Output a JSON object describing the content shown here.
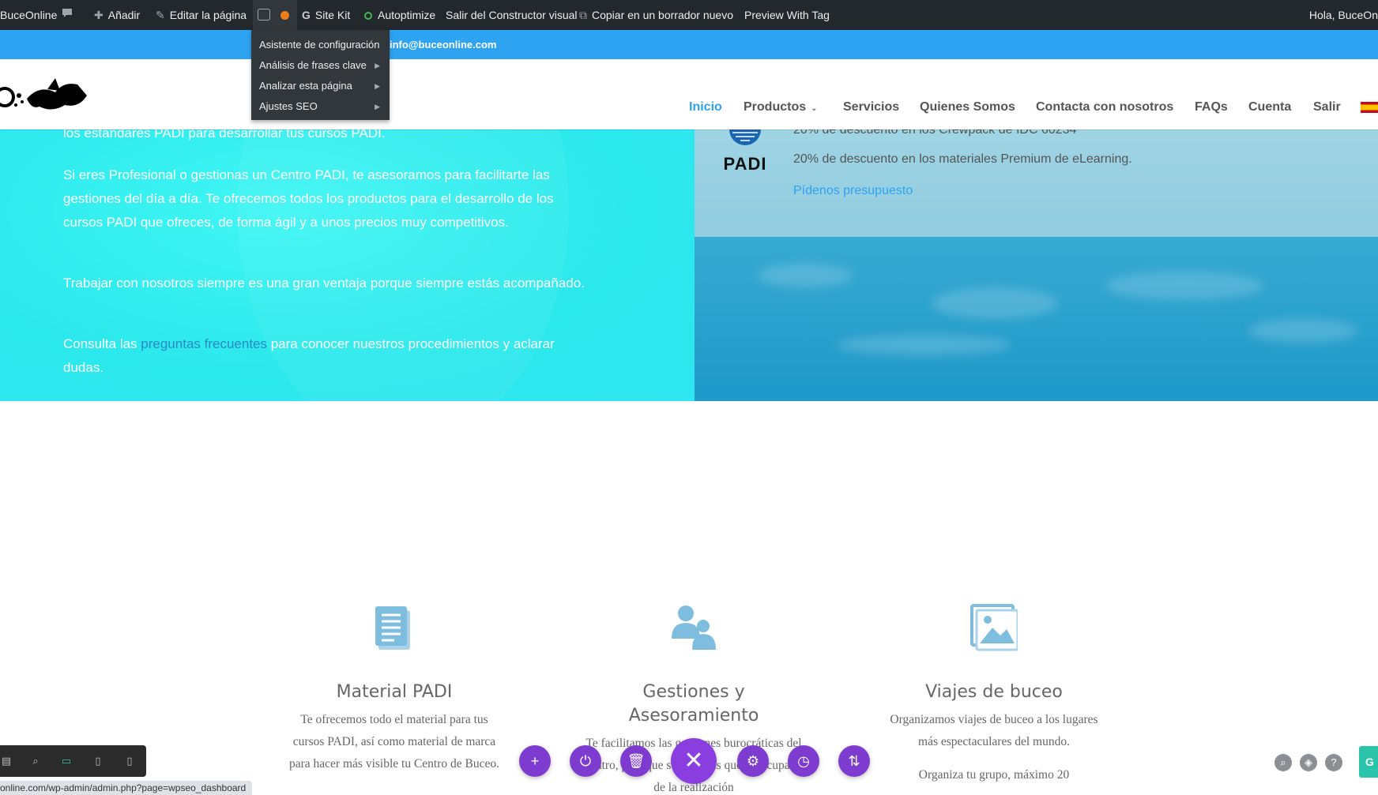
{
  "adminbar": {
    "site_name": "BuceOnline",
    "add_label": "Añadir",
    "edit_label": "Editar la página",
    "sitekit_label": "Site Kit",
    "autoptimize_label": "Autoptimize",
    "exit_builder_label": "Salir del Constructor visual",
    "copy_draft_label": "Copiar en un borrador nuevo",
    "preview_tag_label": "Preview With Tag",
    "greeting": "Hola, BuceOn"
  },
  "yoast_menu": {
    "items": [
      {
        "label": "Asistente de configuración",
        "submenu": false
      },
      {
        "label": "Análisis de frases clave",
        "submenu": true
      },
      {
        "label": "Analizar esta página",
        "submenu": true
      },
      {
        "label": "Ajustes SEO",
        "submenu": true
      }
    ]
  },
  "topbar": {
    "email": "info@buceonline.com"
  },
  "nav": {
    "items": [
      "Inicio",
      "Productos",
      "Servicios",
      "Quienes Somos",
      "Contacta con nosotros",
      "FAQs",
      "Cuenta",
      "Salir"
    ]
  },
  "hero": {
    "p1": "los estándares PADI para desarrollar tus cursos PADI.",
    "p2": "Si eres Profesional o gestionas un Centro PADI, te asesoramos para facilitarte las gestiones del día a día. Te ofrecemos todos los productos para el desarrollo de los cursos PADI que ofreces, de forma ágil y a unos precios muy competitivos.",
    "p3": "Trabajar con nosotros siempre es una gran ventaja porque siempre estás acompañado.",
    "p4_before": "Consulta las ",
    "p4_link": "preguntas frecuentes",
    "p4_after": " para conocer nuestros procedimientos y aclarar dudas."
  },
  "offer": {
    "padi_label": "PADI",
    "line1": "20% de descuento en los Crewpack de IDC 60234",
    "line2": "20% de descuento en los materiales Premium de eLearning.",
    "link": "Pídenos presupuesto"
  },
  "features": [
    {
      "title": "Material PADI",
      "text": "Te ofrecemos todo el material para tus cursos PADI, así como material de marca para hacer más visible tu Centro de Buceo."
    },
    {
      "title": "Gestiones y Asesoramiento",
      "text": "Te facilitamos las gestiones burocráticas del centro, para que solo tengas que preocuparte de la realización"
    },
    {
      "title": "Viajes de buceo",
      "text": "Organizamos viajes de buceo a los lugares más espectaculares del mundo.",
      "text2": "Organiza tu grupo, máximo 20"
    }
  ],
  "status_url": "online.com/wp-admin/admin.php?page=wpseo_dashboard",
  "colors": {
    "accent": "#2ea3f2",
    "builder_purple": "#7e3bd0",
    "hero_cyan": "#2ee8ef"
  }
}
